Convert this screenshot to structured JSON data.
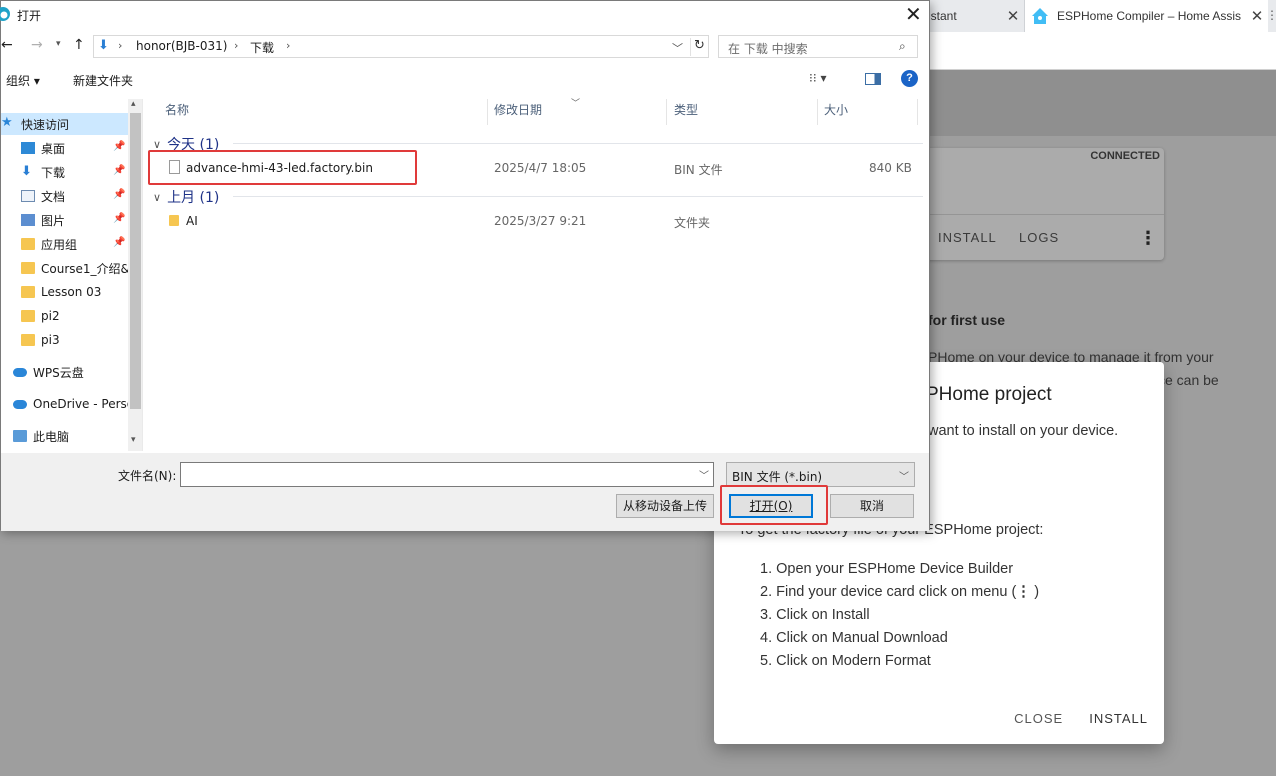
{
  "browser": {
    "tabs": [
      {
        "title": "istant",
        "close": "✕"
      },
      {
        "title": "ESPHome Compiler – Home Assis",
        "close": "✕"
      }
    ],
    "extra": "⋮"
  },
  "device_card": {
    "status": "CONNECTED",
    "install_label": "INSTALL",
    "logs_label": "LOGS",
    "menu_icon": "kebab-menu-icon"
  },
  "background_text": {
    "heading": "for first use",
    "line1": "PHome on your device to manage it from your",
    "line2": "ce can be"
  },
  "esphome_dialog": {
    "title": "PHome project",
    "subtitle": "want to install on your device.",
    "factory_text": "To get the factory file of your ESPHome project:",
    "steps": [
      "1. Open your ESPHome Device Builder",
      "2. Find your device card click on menu (",
      "3. Click on Install",
      "4. Click on Manual Download",
      "5. Click on Modern Format"
    ],
    "step2_suffix": " )",
    "close_label": "CLOSE",
    "install_label": "INSTALL"
  },
  "file_dialog": {
    "title": "打开",
    "close_glyph": "✕",
    "breadcrumb": [
      "honor(BJB-031)",
      "下载"
    ],
    "search_placeholder": "在 下载 中搜索",
    "toolbar": {
      "organize": "组织 ▾",
      "new_folder": "新建文件夹",
      "view": "⁝⁝ ▾",
      "help": "?"
    },
    "nav_items": [
      {
        "label": "快速访问",
        "icon": "star-icon",
        "pinned": false
      },
      {
        "label": "桌面",
        "icon": "desktop-icon",
        "pinned": true
      },
      {
        "label": "下载",
        "icon": "download-icon",
        "pinned": true
      },
      {
        "label": "文档",
        "icon": "document-icon",
        "pinned": true
      },
      {
        "label": "图片",
        "icon": "picture-icon",
        "pinned": true
      },
      {
        "label": "应用组",
        "icon": "folder-icon",
        "pinned": true
      },
      {
        "label": "Course1_介绍&",
        "icon": "folder-icon",
        "pinned": false
      },
      {
        "label": "Lesson 03",
        "icon": "folder-icon",
        "pinned": false
      },
      {
        "label": "pi2",
        "icon": "folder-icon",
        "pinned": false
      },
      {
        "label": "pi3",
        "icon": "folder-icon",
        "pinned": false
      },
      {
        "label": "WPS云盘",
        "icon": "cloud-icon",
        "pinned": false
      },
      {
        "label": "OneDrive - Perso",
        "icon": "onedrive-icon",
        "pinned": false
      },
      {
        "label": "此电脑",
        "icon": "pc-icon",
        "pinned": false
      }
    ],
    "columns": [
      "名称",
      "修改日期",
      "类型",
      "大小"
    ],
    "groups": [
      {
        "label": "今天 (1)",
        "rows": [
          {
            "name": "advance-hmi-43-led.factory.bin",
            "date": "2025/4/7 18:05",
            "type": "BIN 文件",
            "size": "840 KB",
            "icon": "file-icon"
          }
        ]
      },
      {
        "label": "上月 (1)",
        "rows": [
          {
            "name": "AI",
            "date": "2025/3/27 9:21",
            "type": "文件夹",
            "size": "",
            "icon": "folder-icon"
          }
        ]
      }
    ],
    "filename_label": "文件名(N):",
    "filename_value": "",
    "filetype": "BIN 文件 (*.bin)",
    "upload_label": "从移动设备上传",
    "open_label": "打开(O)",
    "cancel_label": "取消"
  },
  "colors": {
    "highlight": "#e03a3a",
    "accent": "#0078d7",
    "selected": "#cce8ff"
  }
}
